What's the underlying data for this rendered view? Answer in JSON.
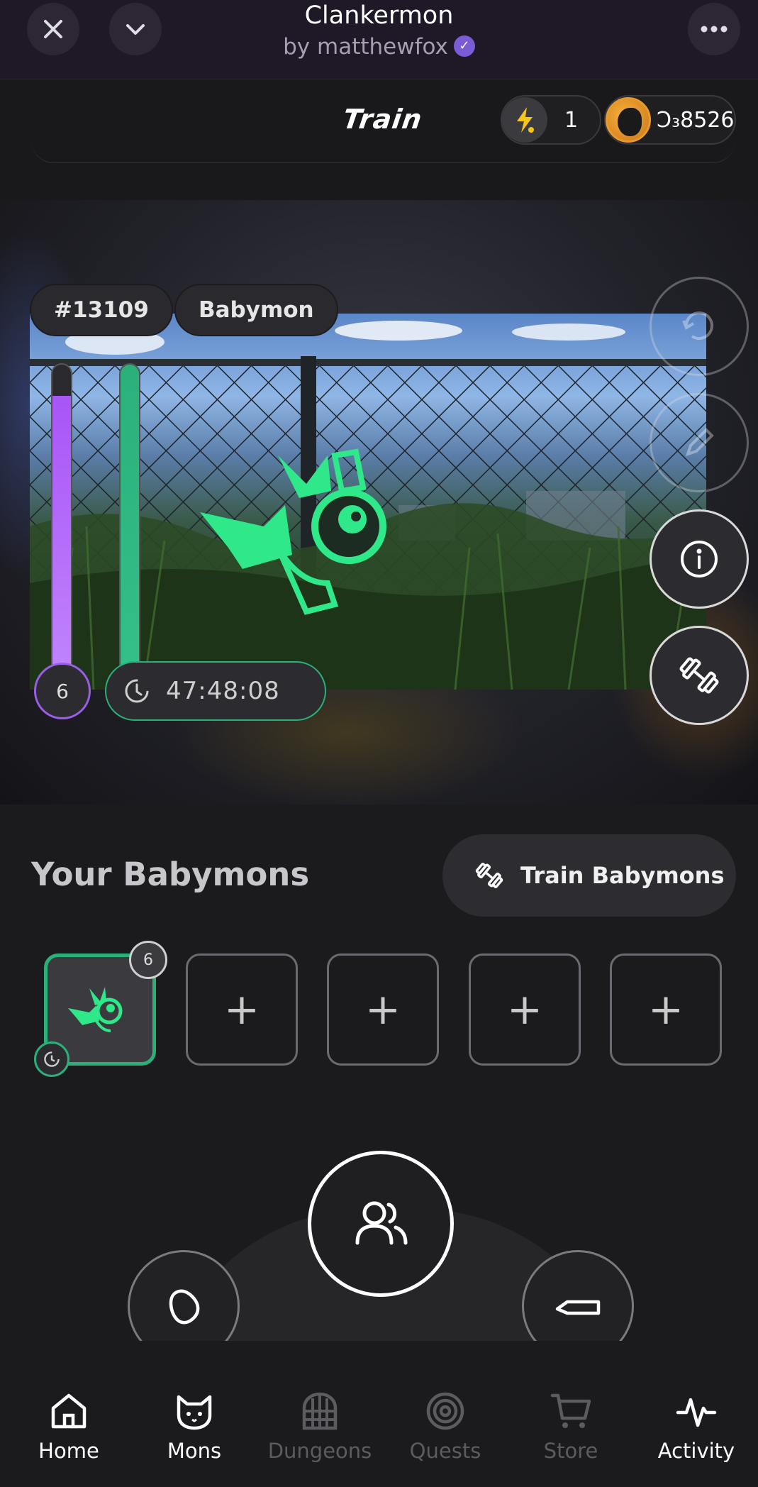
{
  "app": {
    "title": "Clankermon",
    "subtitle": "by matthewfox",
    "close_icon": "close-icon",
    "collapse_icon": "chevron-down-icon",
    "more_icon": "more-icon"
  },
  "header": {
    "title": "Train",
    "energy": "1",
    "coins": "Ↄ₃8526"
  },
  "mon": {
    "id_tag": "#13109",
    "stage_tag": "Babymon",
    "level": "6",
    "timer": "47:48:08",
    "xp_fill": 0.9,
    "energy_fill": 1.0
  },
  "colors": {
    "xp": "#9b5de5",
    "energy": "#2bb07a",
    "accent": "#2ee88a"
  },
  "section": {
    "title": "Your Babymons",
    "train_button": "Train Babymons"
  },
  "slots": {
    "active_level": "6",
    "plus": "+"
  },
  "nav": [
    {
      "label": "Home",
      "icon": "home-icon"
    },
    {
      "label": "Mons",
      "icon": "cat-icon"
    },
    {
      "label": "Dungeons",
      "icon": "gate-icon"
    },
    {
      "label": "Quests",
      "icon": "target-icon"
    },
    {
      "label": "Store",
      "icon": "cart-icon"
    },
    {
      "label": "Activity",
      "icon": "activity-icon"
    }
  ]
}
